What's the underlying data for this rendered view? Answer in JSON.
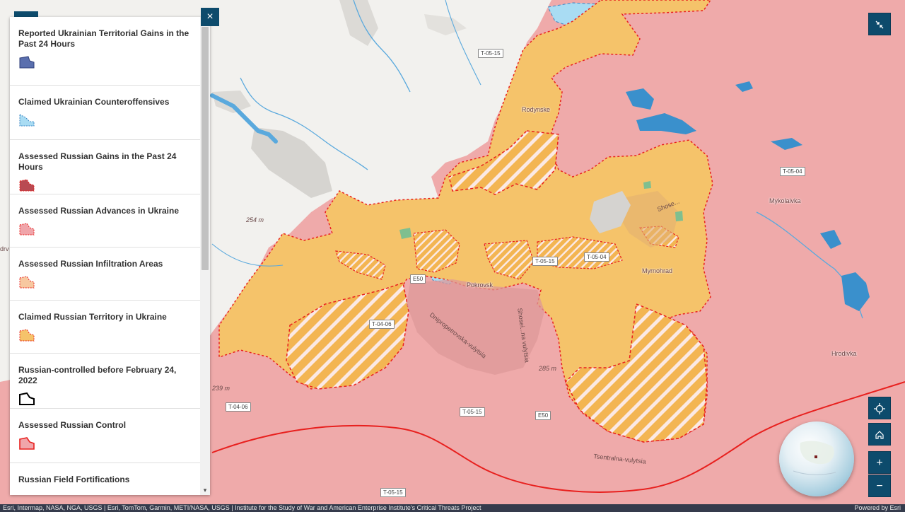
{
  "legend": {
    "items": [
      {
        "label": "Reported Ukrainian Territorial Gains in the Past 24 Hours",
        "swatch": "ukr-gains"
      },
      {
        "label": "Claimed Ukrainian Counteroffensives",
        "swatch": "ukr-counter"
      },
      {
        "label": "Assessed Russian Gains in the Past 24 Hours",
        "swatch": "rus-gains"
      },
      {
        "label": "Assessed Russian Advances in Ukraine",
        "swatch": "rus-advances"
      },
      {
        "label": "Assessed Russian Infiltration Areas",
        "swatch": "rus-infiltration"
      },
      {
        "label": "Claimed Russian Territory in Ukraine",
        "swatch": "rus-claimed"
      },
      {
        "label": "Russian-controlled before February 24, 2022",
        "swatch": "pre-2022"
      },
      {
        "label": "Assessed Russian Control",
        "swatch": "rus-control"
      },
      {
        "label": "Russian Field Fortifications",
        "swatch": "fortifications"
      }
    ],
    "close_label": "×",
    "scroll_down_icon": "▾"
  },
  "map": {
    "towns": [
      {
        "name": "Rodynske"
      },
      {
        "name": "Pokrovsk"
      },
      {
        "name": "Myrnohrad"
      },
      {
        "name": "Mykolaivka"
      },
      {
        "name": "Hrodivka"
      }
    ],
    "roads": [
      {
        "name": "T-05-15"
      },
      {
        "name": "T-05-04"
      },
      {
        "name": "T-05-04"
      },
      {
        "name": "T-05-15"
      },
      {
        "name": "E50"
      },
      {
        "name": "T-04-06"
      },
      {
        "name": "T-04-06"
      },
      {
        "name": "T-05-15"
      },
      {
        "name": "E50"
      },
      {
        "name": "T-05-15"
      }
    ],
    "street_labels": {
      "dnipro": "Dnipropetrovska-vulytsia",
      "shosei": "Shosei...na vulytsia",
      "tsentralna": "Tsentralna-vulytsia",
      "shose_ne": "Shose..."
    },
    "elevations": [
      "254 m",
      "285 m",
      "239 m"
    ],
    "edge_label": "drv",
    "colors": {
      "russian_control": "#efa9a9",
      "claimed": "#f5c36a",
      "infiltration_stripe": "#f3b552",
      "boundary": "#e8201e",
      "water": "#5aa9dd",
      "ukr_blue": "#a9dcf3",
      "panel_button": "#0d4b6c"
    }
  },
  "controls": {
    "expand_icon": "collapse-arrows-icon",
    "locate_icon": "crosshair-icon",
    "home_icon": "home-icon",
    "zoom_in_label": "+",
    "zoom_out_label": "−"
  },
  "attribution": {
    "text": "Esri, Intermap, NASA, NGA, USGS | Esri, TomTom, Garmin, METI/NASA, USGS | Institute for the Study of War and American Enterprise Institute's Critical Threats Project",
    "powered_by": "Powered by Esri"
  }
}
